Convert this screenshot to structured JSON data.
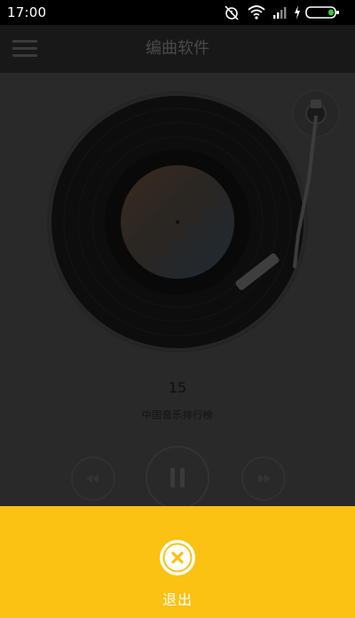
{
  "status_bar": {
    "time": "17:00",
    "icons": [
      "alarm-off-icon",
      "wifi-icon",
      "signal-icon",
      "charging-icon",
      "battery-icon"
    ]
  },
  "header": {
    "title": "编曲软件",
    "menu_icon": "hamburger-menu-icon"
  },
  "player": {
    "track_number": "15",
    "track_title": "中国音乐排行榜",
    "controls": [
      "previous-icon",
      "pause-icon",
      "next-icon"
    ]
  },
  "exit_sheet": {
    "label": "退出",
    "icon": "close-icon"
  },
  "colors": {
    "accent": "#fbc113",
    "background": "#292929",
    "status_bar": "#000000"
  }
}
